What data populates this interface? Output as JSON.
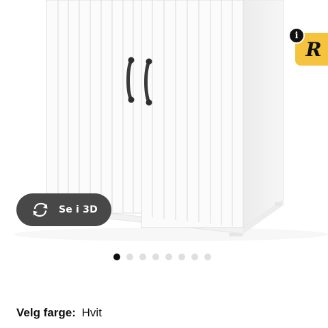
{
  "product": {
    "image_alt": "White cabinet with two doors",
    "view_3d": {
      "label": "Se i 3D",
      "icon": "rotate-3d-icon"
    },
    "badge": {
      "info": "i",
      "letter": "R",
      "color": "#f5c33e"
    }
  },
  "carousel": {
    "dots": [
      {
        "active": true
      },
      {
        "active": false
      },
      {
        "active": false
      },
      {
        "active": false
      },
      {
        "active": false
      },
      {
        "active": false
      },
      {
        "active": false
      },
      {
        "active": false
      }
    ]
  },
  "color_choice": {
    "label": "Velg farge:",
    "value": "Hvit"
  },
  "colors": {
    "button_bg": "#484848",
    "dot_active": "#111111",
    "dot_inactive": "#dfdfdf"
  }
}
